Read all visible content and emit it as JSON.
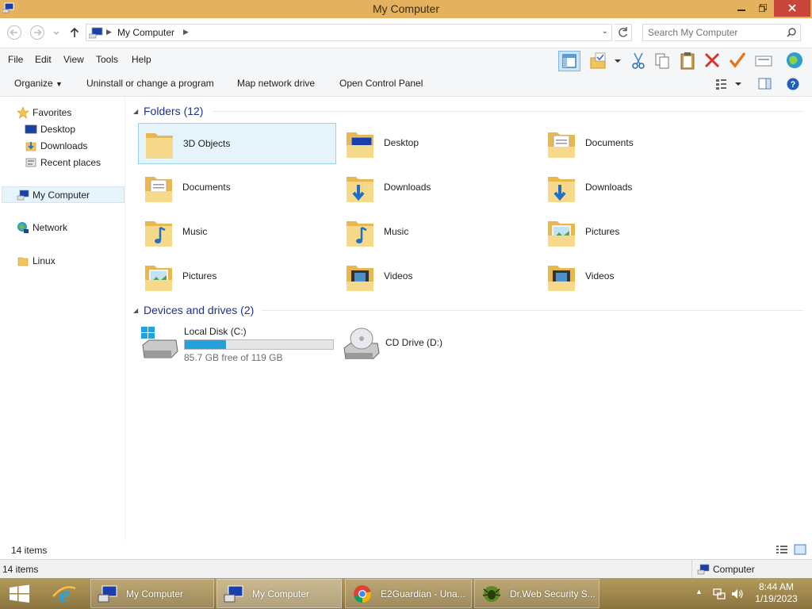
{
  "window": {
    "title": "My Computer",
    "minimize_icon": "minimize-icon",
    "maximize_icon": "restore-icon",
    "close_icon": "close-icon"
  },
  "address_bar": {
    "breadcrumb": "My Computer",
    "search_placeholder": "Search My Computer"
  },
  "menu": {
    "items": [
      "File",
      "Edit",
      "View",
      "Tools",
      "Help"
    ],
    "toolbar_icons": [
      "layout-pane-icon",
      "folder-check-icon",
      "cut-icon",
      "copy-icon",
      "paste-icon",
      "delete-icon",
      "checkmark-icon",
      "rename-icon",
      "globe-icon"
    ]
  },
  "commands": {
    "organize": "Organize",
    "uninstall": "Uninstall or change a program",
    "map_drive": "Map network drive",
    "control_panel": "Open Control Panel"
  },
  "nav": {
    "favorites": "Favorites",
    "desktop": "Desktop",
    "downloads": "Downloads",
    "recent": "Recent places",
    "computer": "My Computer",
    "network": "Network",
    "linux": "Linux"
  },
  "folders_group": "Folders (12)",
  "folders": [
    {
      "name": "3D Objects",
      "icon": "folder-3d-icon"
    },
    {
      "name": "Desktop",
      "icon": "folder-desktop-icon"
    },
    {
      "name": "Documents",
      "icon": "folder-documents-icon"
    },
    {
      "name": "Documents",
      "icon": "folder-documents-icon"
    },
    {
      "name": "Downloads",
      "icon": "folder-downloads-icon"
    },
    {
      "name": "Downloads",
      "icon": "folder-downloads-icon"
    },
    {
      "name": "Music",
      "icon": "folder-music-icon"
    },
    {
      "name": "Music",
      "icon": "folder-music-icon"
    },
    {
      "name": "Pictures",
      "icon": "folder-pictures-icon"
    },
    {
      "name": "Pictures",
      "icon": "folder-pictures-icon"
    },
    {
      "name": "Videos",
      "icon": "folder-videos-icon"
    },
    {
      "name": "Videos",
      "icon": "folder-videos-icon"
    }
  ],
  "drives_group": "Devices and drives (2)",
  "drives": {
    "c_name": "Local Disk (C:)",
    "c_free": "85.7 GB free of 119 GB",
    "c_used_fraction": 0.28,
    "d_name": "CD Drive (D:)"
  },
  "status": {
    "items": "14 items",
    "items_bottom": "14 items",
    "location": "Computer"
  },
  "taskbar": {
    "t1": "My Computer",
    "t2": "My Computer",
    "t3": "E2Guardian - Una...",
    "t4": "Dr.Web Security S...",
    "time": "8:44 AM",
    "date": "1/19/2023"
  }
}
